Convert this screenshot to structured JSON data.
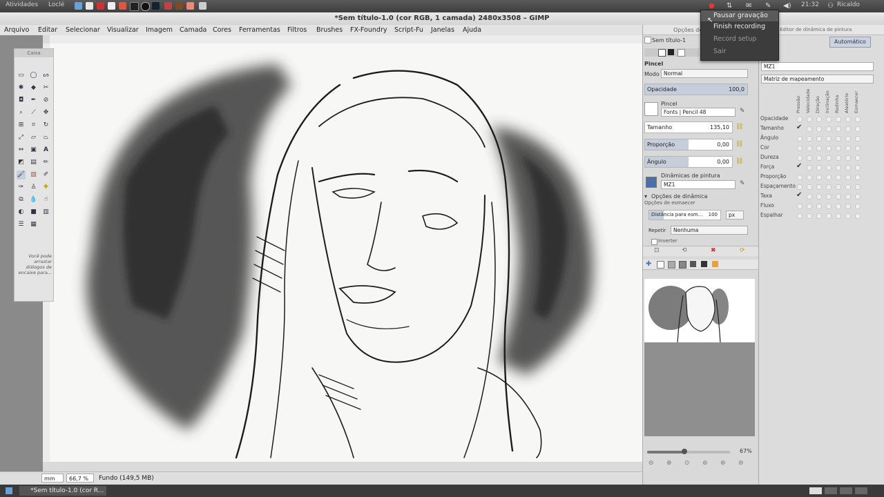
{
  "top_panel": {
    "activities": "Atividades",
    "location": "Loclé",
    "clock": "21:32",
    "user": "Ricaldo"
  },
  "recording_menu": {
    "items": [
      "Pausar gravação",
      "Finish recording",
      "Record setup",
      "Sair"
    ]
  },
  "window": {
    "title": "*Sem título-1.0 (cor RGB, 1 camada) 2480x3508 – GIMP"
  },
  "menu": [
    "Arquivo",
    "Editar",
    "Selecionar",
    "Visualizar",
    "Imagem",
    "Camada",
    "Cores",
    "Ferramentas",
    "Filtros",
    "Brushes",
    "FX-Foundry",
    "Script-Fu",
    "Janelas",
    "Ajuda"
  ],
  "toolbox": {
    "title": "Caixa",
    "hint": "Você pode arrastar diálogos de encaixe para..."
  },
  "status": {
    "unit": "mm",
    "zoom": "66,7 %",
    "info": "Fundo (149,5 MB)"
  },
  "taskbar": {
    "task": "*Sem título-1.0 (cor R..."
  },
  "tool_options": {
    "header_left": "Opções de...",
    "image_name": "Sem título-1",
    "tool_name": "Pincel",
    "mode_label": "Modo",
    "mode_value": "Normal",
    "opacity_label": "Opacidade",
    "opacity_value": "100,0",
    "opacity_fraction": 1.0,
    "brush_label": "Pincel",
    "brush_value": "Fonts | Pencil 48",
    "size_label": "Tamanho",
    "size_value": "135,10",
    "size_fraction": 0.0,
    "ratio_label": "Proporção",
    "ratio_value": "0,00",
    "ratio_fraction": 0.5,
    "angle_label": "Ângulo",
    "angle_value": "0,00",
    "angle_fraction": 0.5,
    "dynamics_label": "Dinâmicas de pintura",
    "dynamics_value": "MZ1",
    "dyn_options_label": "Opções de dinâmica",
    "fade_options_label": "Opções de esmaecer",
    "fade_length_label": "Distância para esm...",
    "fade_length_value": "100",
    "fade_unit": "px",
    "repeat_label": "Repetir",
    "repeat_value": "Nenhuma",
    "reverse_label": "Inverter"
  },
  "navigation": {
    "zoom": "67%",
    "zoom_fraction": 0.45
  },
  "dynamics_editor": {
    "header": "Editor de dinâmica de pintura",
    "auto": "Automático",
    "name": "MZ1",
    "mapping_label": "Matriz de mapeamento",
    "columns": [
      "Pressão",
      "Velocidade",
      "Direção",
      "Inclinação",
      "Rodinha",
      "Aleatório",
      "Esmaecer"
    ],
    "rows": [
      {
        "label": "Opacidade",
        "checked": []
      },
      {
        "label": "Tamanho",
        "checked": [
          0
        ]
      },
      {
        "label": "Ângulo",
        "checked": []
      },
      {
        "label": "Cor",
        "checked": []
      },
      {
        "label": "Dureza",
        "checked": []
      },
      {
        "label": "Força",
        "checked": [
          0
        ]
      },
      {
        "label": "Proporção",
        "checked": []
      },
      {
        "label": "Espaçamento",
        "checked": []
      },
      {
        "label": "Taxa",
        "checked": [
          0
        ]
      },
      {
        "label": "Fluxo",
        "checked": []
      },
      {
        "label": "Espalhar",
        "checked": []
      }
    ]
  },
  "colors": {
    "accent": "#c6cedb",
    "menu_bg": "#3c3c3c",
    "chain": "#c9a400"
  }
}
